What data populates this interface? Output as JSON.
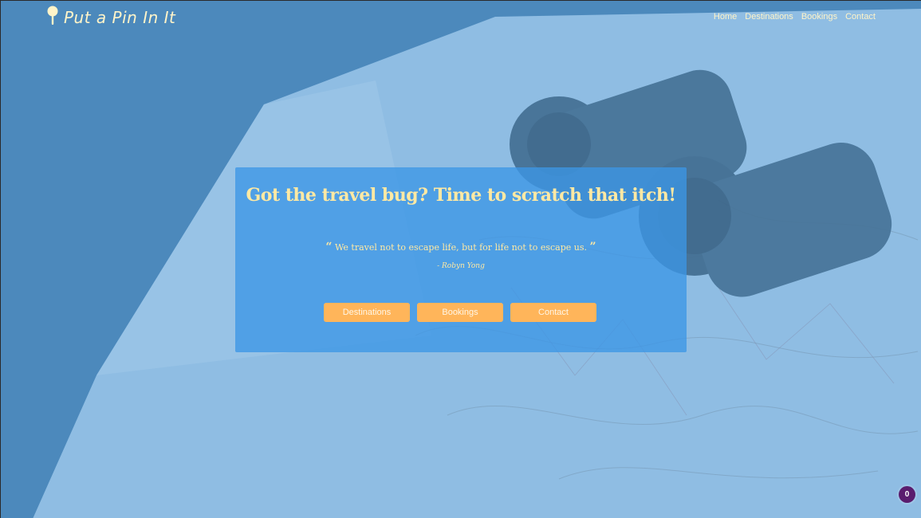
{
  "brand": {
    "name": "Put a Pin In It",
    "icon": "map-pin-icon"
  },
  "nav": {
    "items": [
      {
        "label": "Home"
      },
      {
        "label": "Destinations"
      },
      {
        "label": "Bookings"
      },
      {
        "label": "Contact"
      }
    ]
  },
  "hero": {
    "background": "map-and-binoculars-photo",
    "headline": "Got the travel bug? Time to scratch that itch!",
    "quote_open": "“",
    "quote_text": "We travel not to escape life, but for life not to escape us.",
    "quote_close": "”",
    "author": "- Robyn Yong",
    "buttons": [
      {
        "label": "Destinations"
      },
      {
        "label": "Bookings"
      },
      {
        "label": "Contact"
      }
    ]
  },
  "badge": {
    "count": "0"
  },
  "colors": {
    "overlay": "#5fa5e1",
    "panel": "#3c96e6",
    "accent_text": "#ffe9a3",
    "button": "#ffb55a",
    "badge": "#5a1d6e"
  }
}
